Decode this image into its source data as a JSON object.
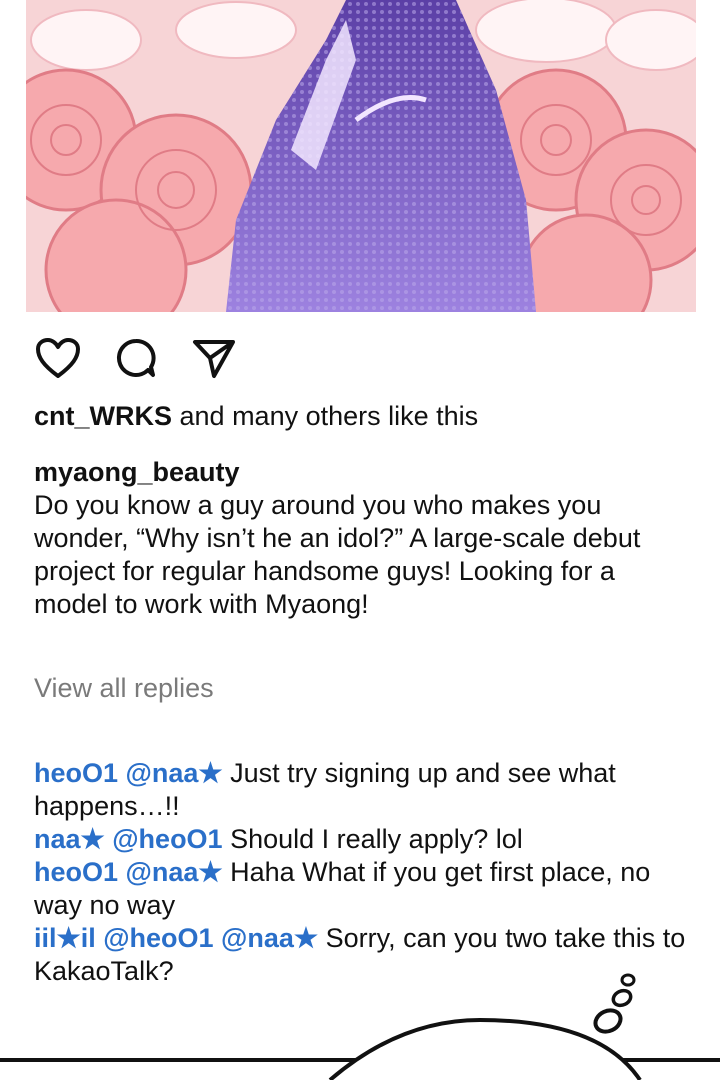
{
  "post": {
    "image_alt": "Illustration of a figure in a purple suit surrounded by pink roses and daisies",
    "colors": {
      "background": "#f6c9cc",
      "suit": "#6a4fb3",
      "rose_line": "#e07c86"
    }
  },
  "actions": {
    "like_icon": "heart-icon",
    "comment_icon": "comment-icon",
    "share_icon": "send-icon"
  },
  "likes": {
    "user": "cnt_WRKS",
    "text": " and many others like this"
  },
  "caption": {
    "user": "myaong_beauty",
    "text": "Do you know a guy around you who makes you wonder, “Why isn’t he an idol?” A large-scale debut project for regular handsome guys! Looking for a model to work with Myaong!"
  },
  "view_replies": "View all replies",
  "replies": [
    {
      "mentions": "heoO1 @naa★",
      "text": " Just try signing up and see what happens…!!"
    },
    {
      "mentions": "naa★ @heoO1",
      "text": " Should I really apply? lol"
    },
    {
      "mentions": "heoO1 @naa★",
      "text": " Haha What if you get first place, no way no way"
    },
    {
      "mentions": "iil★il @heoO1 @naa★",
      "text": " Sorry, can you two take this to KakaoTalk?"
    }
  ],
  "colors": {
    "mention": "#2a6fc9",
    "muted": "#7a7a7a"
  }
}
